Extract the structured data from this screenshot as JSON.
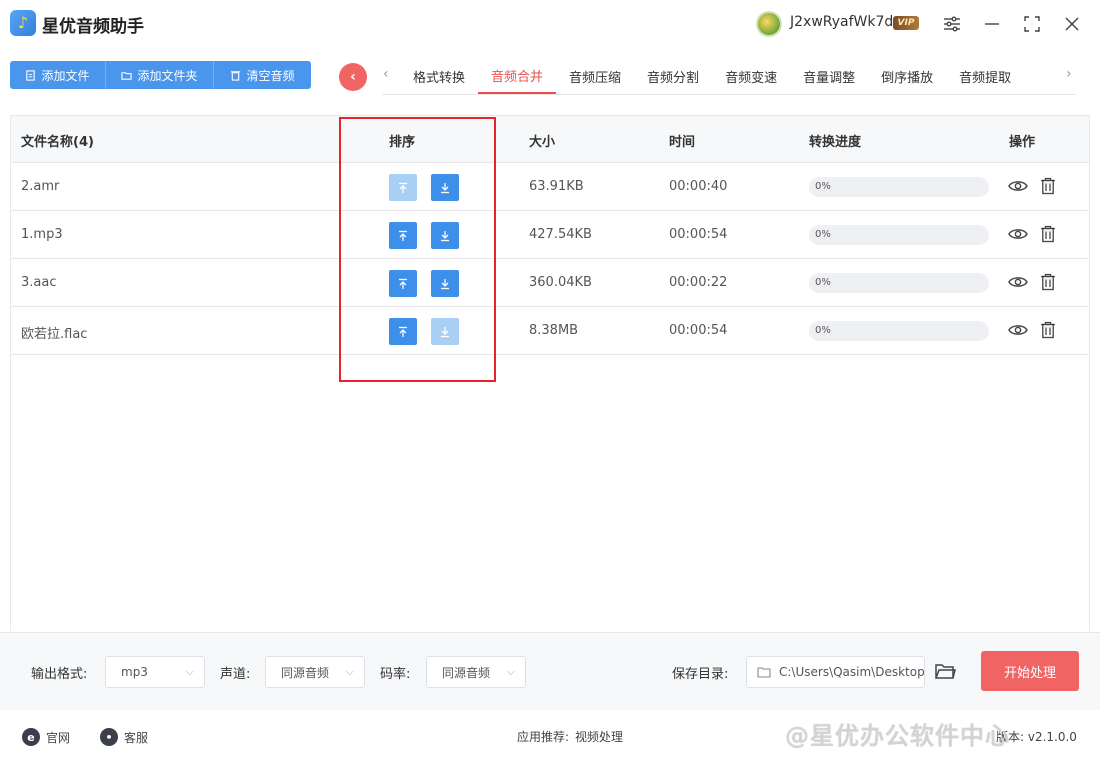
{
  "app": {
    "title": "星优音频助手",
    "username": "J2xwRyafWk7d",
    "vip_badge": "VIP"
  },
  "toolbar": {
    "add_file": "添加文件",
    "add_folder": "添加文件夹",
    "clear_audio": "清空音频"
  },
  "tabs": [
    {
      "label": "格式转换",
      "active": false
    },
    {
      "label": "音频合并",
      "active": true
    },
    {
      "label": "音频压缩",
      "active": false
    },
    {
      "label": "音频分割",
      "active": false
    },
    {
      "label": "音频变速",
      "active": false
    },
    {
      "label": "音量调整",
      "active": false
    },
    {
      "label": "倒序播放",
      "active": false
    },
    {
      "label": "音频提取",
      "active": false
    }
  ],
  "table": {
    "headers": {
      "name": "文件名称(4)",
      "sort": "排序",
      "size": "大小",
      "time": "时间",
      "progress": "转换进度",
      "ops": "操作"
    },
    "rows": [
      {
        "name": "2.amr",
        "size": "63.91KB",
        "time": "00:00:40",
        "progress": "0%",
        "progress_value": 0,
        "up_enabled": false,
        "down_enabled": true
      },
      {
        "name": "1.mp3",
        "size": "427.54KB",
        "time": "00:00:54",
        "progress": "0%",
        "progress_value": 0,
        "up_enabled": true,
        "down_enabled": true
      },
      {
        "name": "3.aac",
        "size": "360.04KB",
        "time": "00:00:22",
        "progress": "0%",
        "progress_value": 0,
        "up_enabled": true,
        "down_enabled": true
      },
      {
        "name": "欧若拉.flac",
        "size": "8.38MB",
        "time": "00:00:54",
        "progress": "0%",
        "progress_value": 0,
        "up_enabled": true,
        "down_enabled": false
      }
    ]
  },
  "settings": {
    "format_label": "输出格式:",
    "format_value": "mp3",
    "channel_label": "声道:",
    "channel_value": "同源音频",
    "bitrate_label": "码率:",
    "bitrate_value": "同源音频",
    "save_label": "保存目录:",
    "save_path": "C:\\Users\\Qasim\\Desktop",
    "start_button": "开始处理"
  },
  "footer": {
    "website": "官网",
    "service": "客服",
    "recommend_label": "应用推荐:",
    "recommend_value": "视频处理",
    "version": "版本: v2.1.0.0",
    "watermark": "@星优办公软件中心"
  },
  "colors": {
    "accent_blue": "#4a96ec",
    "accent_red": "#f06464",
    "highlight_box": "#e8232a"
  }
}
